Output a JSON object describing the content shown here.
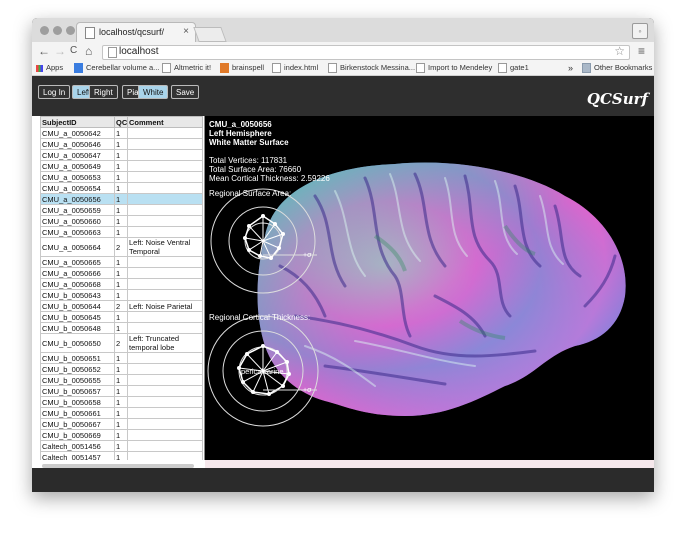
{
  "browser": {
    "tab_title": "localhost/qcsurf/",
    "tab_close": "×",
    "url": "localhost",
    "nav": {
      "back": "←",
      "forward": "→",
      "reload": "C",
      "home": "⌂"
    },
    "bookmarks": [
      "Apps",
      "Cerebellar volume a...",
      "Altmetric it!",
      "brainspell",
      "index.html",
      "Birkenstock Messina...",
      "Import to Mendeley",
      "gate1"
    ],
    "bookmarks_more": "»",
    "other_bookmarks": "Other Bookmarks",
    "star": "☆",
    "menu": "≡"
  },
  "toolbar": {
    "login": "Log In",
    "left": "Left",
    "right": "Right",
    "pial": "Pial",
    "white": "White",
    "save": "Save",
    "brand": "QCSurf"
  },
  "table": {
    "headers": [
      "SubjectID",
      "QC",
      "Comment"
    ],
    "rows": [
      {
        "id": "CMU_a_0050642",
        "qc": "1",
        "comment": ""
      },
      {
        "id": "CMU_a_0050646",
        "qc": "1",
        "comment": ""
      },
      {
        "id": "CMU_a_0050647",
        "qc": "1",
        "comment": ""
      },
      {
        "id": "CMU_a_0050649",
        "qc": "1",
        "comment": ""
      },
      {
        "id": "CMU_a_0050653",
        "qc": "1",
        "comment": ""
      },
      {
        "id": "CMU_a_0050654",
        "qc": "1",
        "comment": ""
      },
      {
        "id": "CMU_a_0050656",
        "qc": "1",
        "comment": "",
        "selected": true
      },
      {
        "id": "CMU_a_0050659",
        "qc": "1",
        "comment": ""
      },
      {
        "id": "CMU_a_0050660",
        "qc": "1",
        "comment": ""
      },
      {
        "id": "CMU_a_0050663",
        "qc": "1",
        "comment": ""
      },
      {
        "id": "CMU_a_0050664",
        "qc": "2",
        "comment": "Left: Noise Ventral Temporal"
      },
      {
        "id": "CMU_a_0050665",
        "qc": "1",
        "comment": ""
      },
      {
        "id": "CMU_a_0050666",
        "qc": "1",
        "comment": ""
      },
      {
        "id": "CMU_a_0050668",
        "qc": "1",
        "comment": ""
      },
      {
        "id": "CMU_b_0050643",
        "qc": "1",
        "comment": ""
      },
      {
        "id": "CMU_b_0050644",
        "qc": "2",
        "comment": "Left: Noise Parietal"
      },
      {
        "id": "CMU_b_0050645",
        "qc": "1",
        "comment": ""
      },
      {
        "id": "CMU_b_0050648",
        "qc": "1",
        "comment": ""
      },
      {
        "id": "CMU_b_0050650",
        "qc": "2",
        "comment": "Left: Truncated temporal lobe"
      },
      {
        "id": "CMU_b_0050651",
        "qc": "1",
        "comment": ""
      },
      {
        "id": "CMU_b_0050652",
        "qc": "1",
        "comment": ""
      },
      {
        "id": "CMU_b_0050655",
        "qc": "1",
        "comment": ""
      },
      {
        "id": "CMU_b_0050657",
        "qc": "1",
        "comment": ""
      },
      {
        "id": "CMU_b_0050658",
        "qc": "1",
        "comment": ""
      },
      {
        "id": "CMU_b_0050661",
        "qc": "1",
        "comment": ""
      },
      {
        "id": "CMU_b_0050667",
        "qc": "1",
        "comment": ""
      },
      {
        "id": "CMU_b_0050669",
        "qc": "1",
        "comment": ""
      },
      {
        "id": "Caltech_0051456",
        "qc": "1",
        "comment": ""
      },
      {
        "id": "Caltech_0051457",
        "qc": "1",
        "comment": ""
      }
    ]
  },
  "viewer": {
    "subject": "CMU_a_0050656",
    "hemisphere": "Left Hemisphere",
    "surface": "White Matter Surface",
    "vertices": "Total Vertices: 117831",
    "area": "Total Surface Area: 76660",
    "thickness": "Mean Cortical Thickness: 2.59226",
    "regional_area_title": "Regional Surface Area:",
    "regional_thickness_title": "Regional Cortical Thickness:",
    "sigma_plus": "+σ",
    "region_label": "pericalcarine"
  }
}
